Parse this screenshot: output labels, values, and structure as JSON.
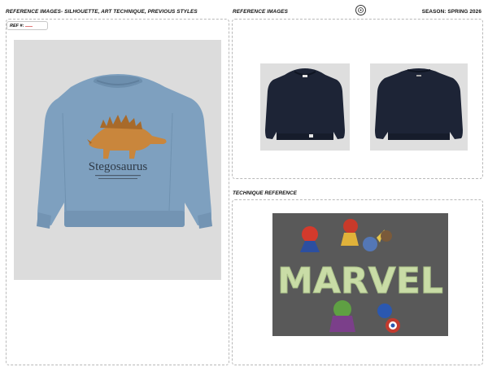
{
  "header": {
    "left_title": "REFERENCE IMAGES- SILHOUETTE, ART TECHNIQUE, PREVIOUS STYLES",
    "mid_title": "REFERENCE IMAGES",
    "season": "SEASON: SPRING 2026"
  },
  "ref": {
    "label": "REF #:"
  },
  "technique": {
    "title": "TECHNIQUE REFERENCE"
  },
  "main_image": {
    "print_word": "Stegosaurus"
  },
  "technique_image": {
    "print_word": "MARVEL"
  },
  "colors": {
    "sweatshirt_blue": "#7ea0bf",
    "sweatshirt_navy": "#1d2436",
    "technique_bg": "#595959",
    "glow_green": "#c9dca6",
    "ref_mark": "#e07a7a"
  }
}
